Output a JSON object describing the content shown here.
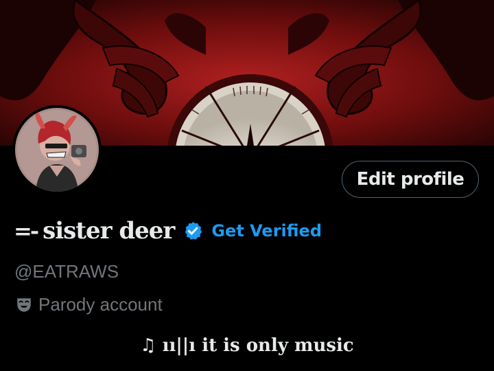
{
  "profile": {
    "name_prefix": "=-",
    "display_name": "sister deer",
    "get_verified_label": "Get Verified",
    "handle": "@EATRAWS",
    "account_label": "Parody account",
    "bio": "♫ ıı||ı it is only music",
    "edit_profile_label": "Edit profile"
  },
  "icons": {
    "verified": "verified-badge-icon",
    "account": "theater-mask-icon"
  },
  "colors": {
    "background": "#000000",
    "accent": "#1d9bf0",
    "secondary_text": "#71767b",
    "primary_text": "#e7e9ea"
  }
}
